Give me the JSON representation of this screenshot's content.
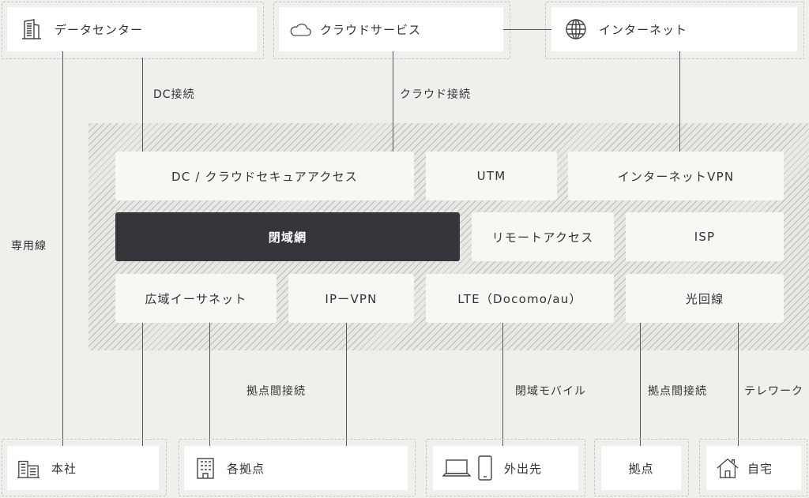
{
  "top": {
    "datacenter": {
      "label": "データセンター",
      "icon": "building-icon"
    },
    "cloud": {
      "label": "クラウドサービス",
      "icon": "cloud-icon"
    },
    "internet": {
      "label": "インターネット",
      "icon": "globe-icon"
    }
  },
  "connection_labels": {
    "dc": "DC接続",
    "cloud": "クラウド接続",
    "dedicated": "専用線",
    "site": "拠点間接続",
    "mobile": "閉域モバイル",
    "site2": "拠点間接続",
    "telework": "テレワーク"
  },
  "services": {
    "dc_cloud_secure": "DC / クラウドセキュアアクセス",
    "utm": "UTM",
    "internet_vpn": "インターネットVPN",
    "closed_network": "閉域網",
    "remote_access": "リモートアクセス",
    "isp": "ISP",
    "wide_ethernet": "広域イーサネット",
    "ip_vpn": "IPーVPN",
    "lte": "LTE（Docomo/au）",
    "fiber": "光回線"
  },
  "bottom": {
    "hq": {
      "label": "本社",
      "icon": "office-building-icon"
    },
    "branches": {
      "label": "各拠点",
      "icon": "building-icon"
    },
    "remote": {
      "label": "外出先",
      "icons": [
        "laptop-icon",
        "smartphone-icon"
      ]
    },
    "site": {
      "label": "拠点"
    },
    "home": {
      "label": "自宅",
      "icon": "house-icon"
    }
  },
  "colors": {
    "background": "#efefeb",
    "dark_box": "#34363c",
    "box": "#f7f7f3",
    "line": "#555555"
  }
}
